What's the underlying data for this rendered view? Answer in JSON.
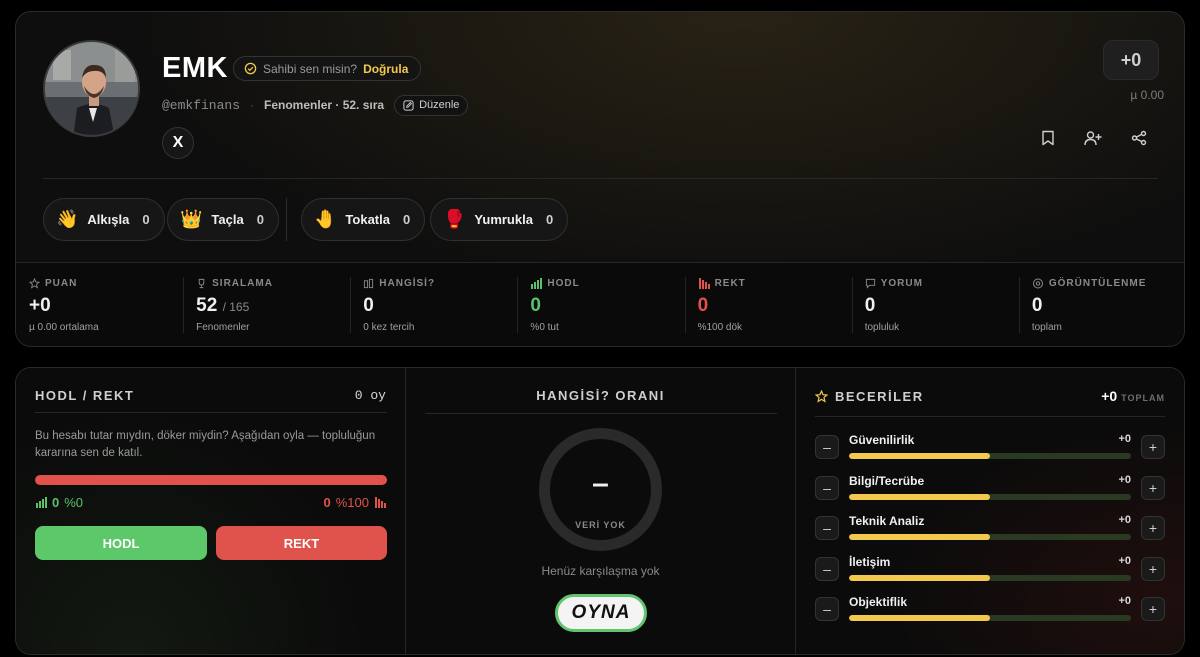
{
  "profile": {
    "name": "EMK",
    "verify_prompt": "Sahibi sen misin?",
    "verify_action": "Doğrula",
    "handle": "@emkfinans",
    "category_rank": "Fenomenler · 52. sıra",
    "edit_label": "Düzenle",
    "x_label": "X",
    "score": "+0",
    "score_sub": "µ 0.00"
  },
  "reactions": [
    {
      "label": "Alkışla",
      "count": "0",
      "emoji": "👋"
    },
    {
      "label": "Taçla",
      "count": "0",
      "emoji": "👑"
    },
    {
      "label": "Tokatla",
      "count": "0",
      "emoji": "🤚"
    },
    {
      "label": "Yumrukla",
      "count": "0",
      "emoji": "🥊"
    }
  ],
  "stats": [
    {
      "label": "PUAN",
      "value": "+0",
      "suffix": "",
      "sub": "µ 0.00 ortalama"
    },
    {
      "label": "SIRALAMA",
      "value": "52",
      "suffix": "/ 165",
      "sub": "Fenomenler"
    },
    {
      "label": "HANGİSİ?",
      "value": "0",
      "suffix": "",
      "sub": "0 kez tercih"
    },
    {
      "label": "HODL",
      "value": "0",
      "suffix": "",
      "sub": "%0 tut"
    },
    {
      "label": "REKT",
      "value": "0",
      "suffix": "",
      "sub": "%100 dök"
    },
    {
      "label": "YORUM",
      "value": "0",
      "suffix": "",
      "sub": "topluluk"
    },
    {
      "label": "GÖRÜNTÜLENME",
      "value": "0",
      "suffix": "",
      "sub": "toplam"
    }
  ],
  "hodl": {
    "title": "HODL / REKT",
    "votes": "0 oy",
    "description": "Bu hesabı tutar mıydın, döker miydin? Aşağıdan oyla — topluluğun kararına sen de katıl.",
    "hodl_count": "0",
    "hodl_pct": "%0",
    "rekt_count": "0",
    "rekt_pct": "%100",
    "hodl_button": "HODL",
    "rekt_button": "REKT"
  },
  "hangisi": {
    "title": "HANGİSİ? ORANI",
    "ring_value": "–",
    "ring_label": "VERİ YOK",
    "empty_text": "Henüz karşılaşma yok",
    "play_button": "OYNA"
  },
  "skills": {
    "title": "BECERİLER",
    "total": "+0",
    "total_label": "TOPLAM",
    "items": [
      {
        "name": "Güvenilirlik",
        "value": "+0",
        "fill": 0.5
      },
      {
        "name": "Bilgi/Tecrübe",
        "value": "+0",
        "fill": 0.5
      },
      {
        "name": "Teknik Analiz",
        "value": "+0",
        "fill": 0.5
      },
      {
        "name": "İletişim",
        "value": "+0",
        "fill": 0.5
      },
      {
        "name": "Objektiflik",
        "value": "+0",
        "fill": 0.5
      }
    ]
  },
  "colors": {
    "accent": "#f2c94c",
    "hodl": "#5cc869",
    "rekt": "#e0534d"
  }
}
